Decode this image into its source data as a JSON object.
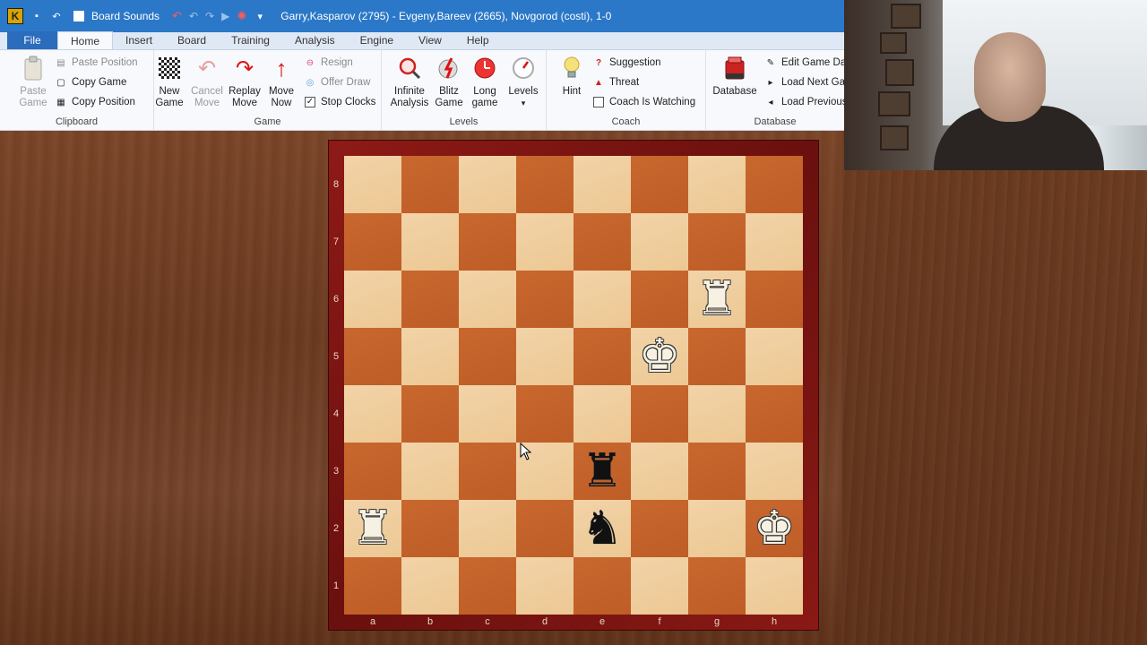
{
  "titlebar": {
    "app_logo": "K",
    "board_sounds_label": "Board Sounds",
    "title": "Garry,Kasparov (2795) - Evgeny,Bareev (2665), Novgorod  (costi), 1-0"
  },
  "menu": {
    "file": "File",
    "tabs": [
      "Home",
      "Insert",
      "Board",
      "Training",
      "Analysis",
      "Engine",
      "View",
      "Help"
    ],
    "active_tab": "Home"
  },
  "ribbon": {
    "clipboard": {
      "paste_game": "Paste\nGame",
      "paste_position": "Paste Position",
      "copy_game": "Copy Game",
      "copy_position": "Copy Position",
      "label": "Clipboard"
    },
    "game": {
      "new_game": "New\nGame",
      "cancel_move": "Cancel\nMove",
      "replay_move": "Replay\nMove",
      "move_now": "Move\nNow",
      "resign": "Resign",
      "offer_draw": "Offer Draw",
      "stop_clocks": "Stop Clocks",
      "stop_clocks_checked": true,
      "label": "Game"
    },
    "levels": {
      "infinite_analysis": "Infinite\nAnalysis",
      "blitz_game": "Blitz\nGame",
      "long_game": "Long\ngame",
      "levels": "Levels",
      "label": "Levels"
    },
    "coach": {
      "hint": "Hint",
      "suggestion": "Suggestion",
      "threat": "Threat",
      "coach_watching": "Coach Is Watching",
      "coach_watching_checked": false,
      "label": "Coach"
    },
    "database": {
      "database": "Database",
      "edit_game_data": "Edit Game Dat",
      "load_next_game": "Load Next Gam",
      "load_previous": "Load Previous",
      "label": "Database"
    }
  },
  "board": {
    "ranks": [
      "8",
      "7",
      "6",
      "5",
      "4",
      "3",
      "2",
      "1"
    ],
    "files": [
      "a",
      "b",
      "c",
      "d",
      "e",
      "f",
      "g",
      "h"
    ],
    "pieces": [
      {
        "square": "g6",
        "glyph": "♜",
        "color": "white",
        "name": "white-rook"
      },
      {
        "square": "f5",
        "glyph": "♚",
        "color": "white",
        "name": "white-king"
      },
      {
        "square": "e3",
        "glyph": "♜",
        "color": "black",
        "name": "black-rook"
      },
      {
        "square": "a2",
        "glyph": "♜",
        "color": "white",
        "name": "white-rook"
      },
      {
        "square": "e2",
        "glyph": "♞",
        "color": "black",
        "name": "black-knight"
      },
      {
        "square": "h2",
        "glyph": "♚",
        "color": "white",
        "name": "white-king"
      }
    ]
  },
  "colors": {
    "titlebar": "#2b78c8",
    "light_square": "#f2d3a8",
    "dark_square": "#c8672e",
    "board_frame": "#8e1a16"
  }
}
